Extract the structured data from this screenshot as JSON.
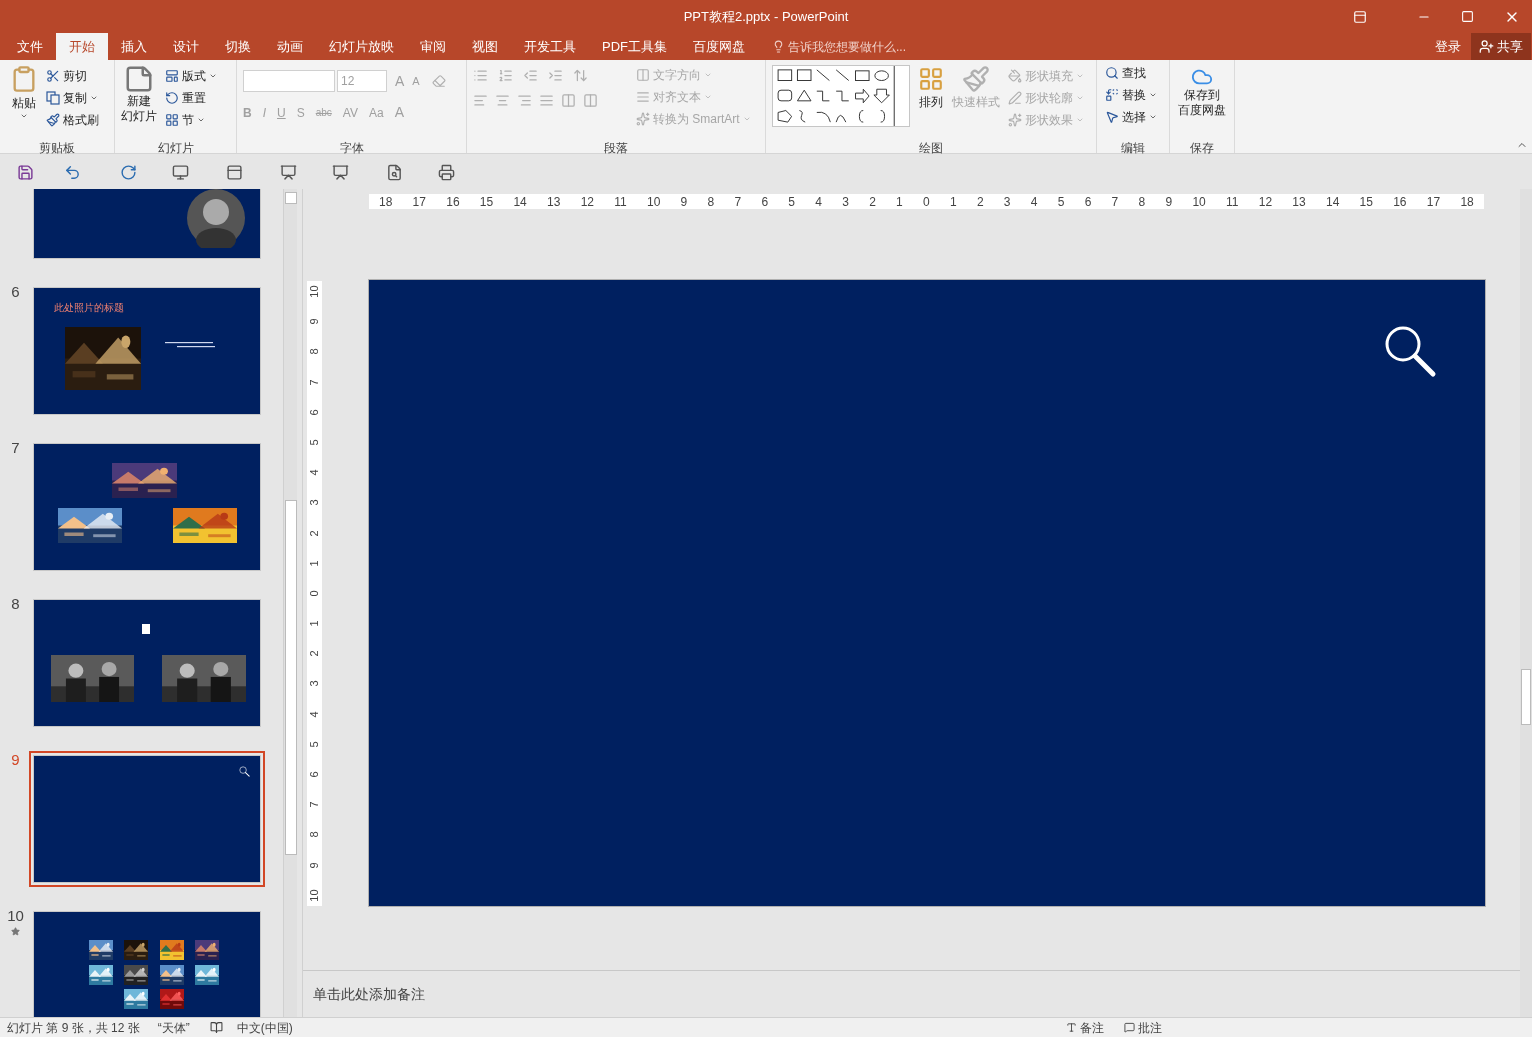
{
  "window": {
    "title": "PPT教程2.pptx - PowerPoint"
  },
  "menu_tabs": [
    {
      "label": "文件",
      "selected": false
    },
    {
      "label": "开始",
      "selected": true
    },
    {
      "label": "插入",
      "selected": false
    },
    {
      "label": "设计",
      "selected": false
    },
    {
      "label": "切换",
      "selected": false
    },
    {
      "label": "动画",
      "selected": false
    },
    {
      "label": "幻灯片放映",
      "selected": false
    },
    {
      "label": "审阅",
      "selected": false
    },
    {
      "label": "视图",
      "selected": false
    },
    {
      "label": "开发工具",
      "selected": false
    },
    {
      "label": "PDF工具集",
      "selected": false
    },
    {
      "label": "百度网盘",
      "selected": false
    }
  ],
  "tell_me": {
    "placeholder": "告诉我您想要做什么..."
  },
  "account": {
    "sign_in": "登录",
    "share": "共享"
  },
  "ribbon": {
    "clipboard": {
      "paste": "粘贴",
      "commands": [
        {
          "label": "剪切"
        },
        {
          "label": "复制"
        },
        {
          "label": "格式刷"
        }
      ],
      "label": "剪贴板"
    },
    "slides": {
      "new_slide": [
        "新建",
        "幻灯片"
      ],
      "commands": [
        {
          "label": "版式"
        },
        {
          "label": "重置"
        },
        {
          "label": "节"
        }
      ],
      "label": "幻灯片"
    },
    "font": {
      "size": "12",
      "grow": "A",
      "shrink": "A",
      "styles": [
        "B",
        "I",
        "U",
        "S",
        "abc",
        "AV",
        "Aa"
      ],
      "font_color": "A",
      "label": "字体"
    },
    "paragraph": {
      "commands": [
        {
          "label": "文字方向",
          "disabled": true
        },
        {
          "label": "对齐文本",
          "disabled": true
        },
        {
          "label": "转换为 SmartArt",
          "disabled": true
        }
      ],
      "label": "段落"
    },
    "drawing": {
      "arrange": "排列",
      "quick_styles": {
        "label": "快速样式",
        "disabled": true
      },
      "commands": [
        {
          "label": "形状填充",
          "disabled": true
        },
        {
          "label": "形状轮廓",
          "disabled": true
        },
        {
          "label": "形状效果",
          "disabled": true
        }
      ],
      "label": "绘图"
    },
    "editing": {
      "commands": [
        {
          "label": "查找"
        },
        {
          "label": "替换"
        },
        {
          "label": "选择"
        }
      ],
      "label": "编辑"
    },
    "save": {
      "button": [
        "保存到",
        "百度网盘"
      ],
      "label": "保存"
    }
  },
  "thumbnails": [
    {
      "kind": "portrait",
      "selected": false
    },
    {
      "number": "6",
      "kind": "title_picture",
      "title": "此处照片的标题",
      "selected": false,
      "animated": false
    },
    {
      "number": "7",
      "kind": "three_pictures",
      "selected": false,
      "animated": false
    },
    {
      "number": "8",
      "kind": "two_photos",
      "selected": false,
      "animated": false
    },
    {
      "number": "9",
      "kind": "magnifier",
      "selected": true,
      "animated": false
    },
    {
      "number": "10",
      "kind": "collage",
      "selected": false,
      "animated": true
    }
  ],
  "ruler": {
    "horizontal": [
      "18",
      "17",
      "16",
      "15",
      "14",
      "13",
      "12",
      "11",
      "10",
      "9",
      "8",
      "7",
      "6",
      "5",
      "4",
      "3",
      "2",
      "1",
      "0",
      "1",
      "2",
      "3",
      "4",
      "5",
      "6",
      "7",
      "8",
      "9",
      "10",
      "11",
      "12",
      "13",
      "14",
      "15",
      "16",
      "17",
      "18"
    ],
    "vertical": [
      "10",
      "9",
      "8",
      "7",
      "6",
      "5",
      "4",
      "3",
      "2",
      "1",
      "0",
      "1",
      "2",
      "3",
      "4",
      "5",
      "6",
      "7",
      "8",
      "9",
      "10"
    ]
  },
  "notes": {
    "placeholder": "单击此处添加备注"
  },
  "status_bar": {
    "slide_info": "幻灯片 第 9 张，共 12 张",
    "theme": "“天体”",
    "language": "中文(中国)",
    "notes": "备注",
    "comments": "批注"
  }
}
